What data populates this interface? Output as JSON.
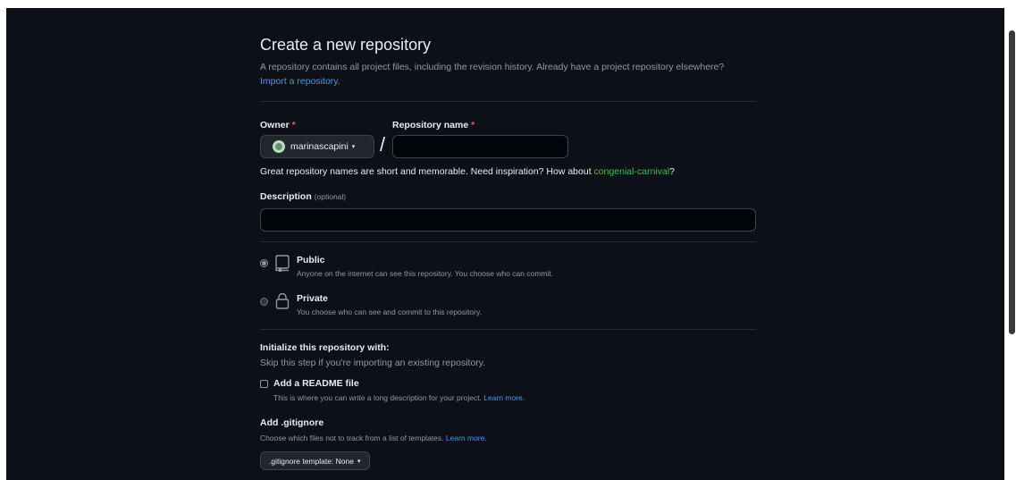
{
  "page": {
    "title": "Create a new repository",
    "subtitle": "A repository contains all project files, including the revision history. Already have a project repository elsewhere?",
    "import_link": "Import a repository."
  },
  "owner": {
    "label": "Owner",
    "required_mark": "*",
    "value": "marinascapini",
    "caret": "▾"
  },
  "repo_name": {
    "label": "Repository name",
    "required_mark": "*",
    "value": "",
    "separator": "/"
  },
  "name_hint": {
    "text": "Great repository names are short and memorable. Need inspiration? How about",
    "suggestion": "congenial-carnival",
    "suffix": "?"
  },
  "description": {
    "label": "Description",
    "optional": "(optional)",
    "value": ""
  },
  "visibility": {
    "public": {
      "title": "Public",
      "desc": "Anyone on the internet can see this repository. You choose who can commit.",
      "selected": true
    },
    "private": {
      "title": "Private",
      "desc": "You choose who can see and commit to this repository.",
      "selected": false
    }
  },
  "init": {
    "title": "Initialize this repository with:",
    "subtitle": "Skip this step if you're importing an existing repository.",
    "readme": {
      "label": "Add a README file",
      "desc": "This is where you can write a long description for your project.",
      "learn_more": "Learn more.",
      "checked": false
    }
  },
  "gitignore": {
    "title": "Add .gitignore",
    "desc": "Choose which files not to track from a list of templates.",
    "learn_more": "Learn more.",
    "select_label": ".gitignore template: None",
    "caret": "▾"
  },
  "colors": {
    "background": "#0d1117",
    "link": "#4493f8",
    "suggestion": "#3fb950",
    "required": "#f85149",
    "muted": "#9198a1"
  }
}
